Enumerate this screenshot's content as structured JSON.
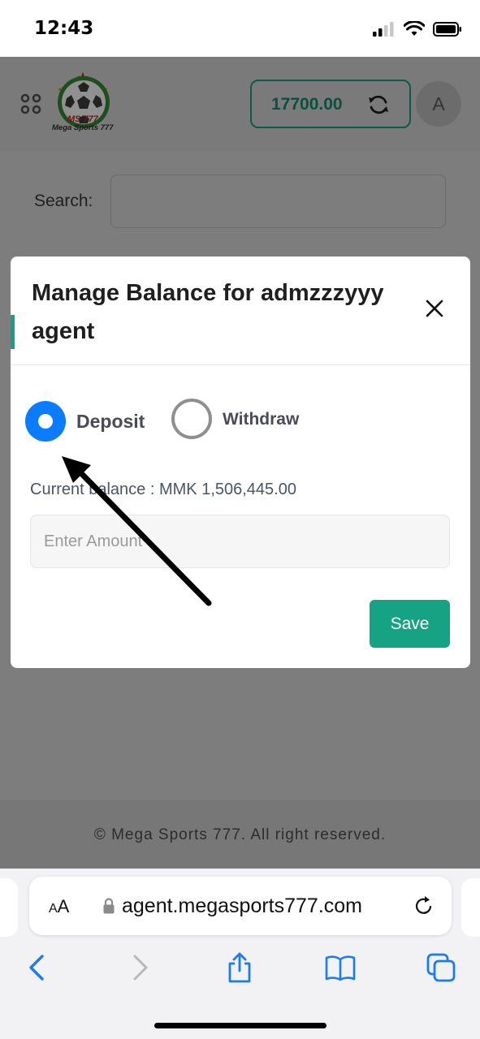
{
  "status_bar": {
    "time": "12:43"
  },
  "header": {
    "logo_text_line1": "MS 777",
    "logo_text_line2": "Mega Sports 777",
    "balance": "17700.00",
    "avatar_letter": "A"
  },
  "search": {
    "label": "Search:"
  },
  "modal": {
    "title": "Manage Balance for admzzzyyy agent",
    "options": [
      {
        "label": "Deposit",
        "selected": true
      },
      {
        "label": "Withdraw",
        "selected": false
      }
    ],
    "current_balance": "Current balance : MMK 1,506,445.00",
    "amount_placeholder": "Enter Amount",
    "save_label": "Save"
  },
  "footer": {
    "text": "© Mega Sports 777. All right reserved."
  },
  "browser": {
    "aa_label_small": "A",
    "aa_label_large": "A",
    "url": "agent.megasports777.com"
  },
  "colors": {
    "accent": "#16a383",
    "radio_selected": "#0a7cff",
    "balance_text": "#0c4f3f"
  }
}
